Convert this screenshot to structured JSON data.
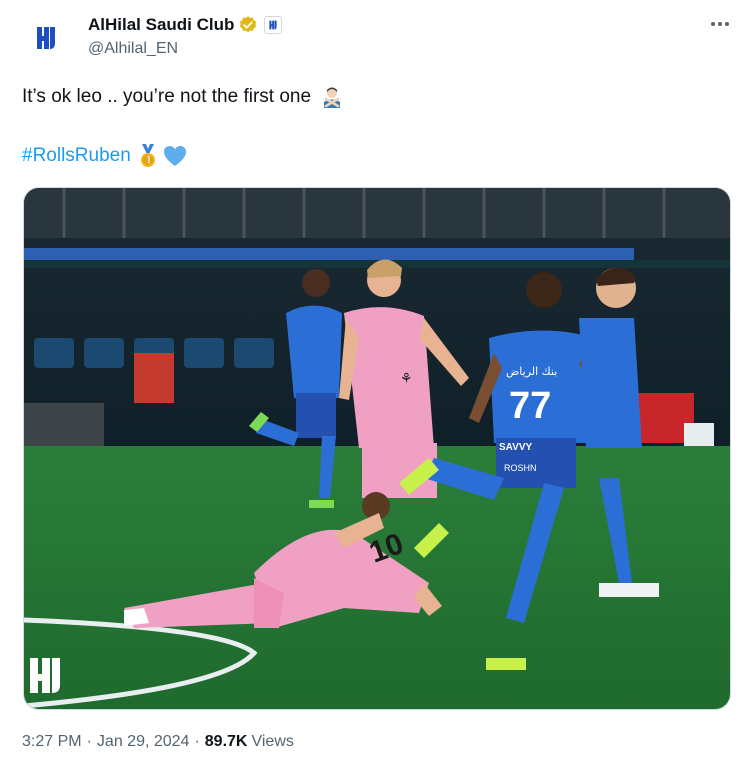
{
  "author": {
    "display_name": "AlHilal Saudi Club",
    "handle": "@Alhilal_EN",
    "verified_icon": "gold-verified-check-icon",
    "affiliate_badge": "alhilal-logo-icon"
  },
  "tweet": {
    "text": "It’s ok leo .. you’re not the first one",
    "emoji": "man-gesturing-no-icon",
    "hashtag": "#RollsRuben",
    "emojis_after_hashtag": [
      "gold-medal-icon",
      "blue-heart-icon"
    ]
  },
  "media": {
    "watermark_icon": "alhilal-logo-icon",
    "jersey_text": [
      "77",
      "بنك الرياض",
      "SAVVY",
      "ROSHN"
    ]
  },
  "meta": {
    "time": "3:27 PM",
    "separator": "·",
    "date": "Jan 29, 2024",
    "views_count": "89.7K",
    "views_label": "Views"
  },
  "colors": {
    "link_blue": "#1d9bf0",
    "verified_gold": "#e2b719",
    "hilal_blue": "#1e4fc2",
    "inter_pink": "#f2a6c6",
    "pitch_green": "#2f8a3d"
  }
}
